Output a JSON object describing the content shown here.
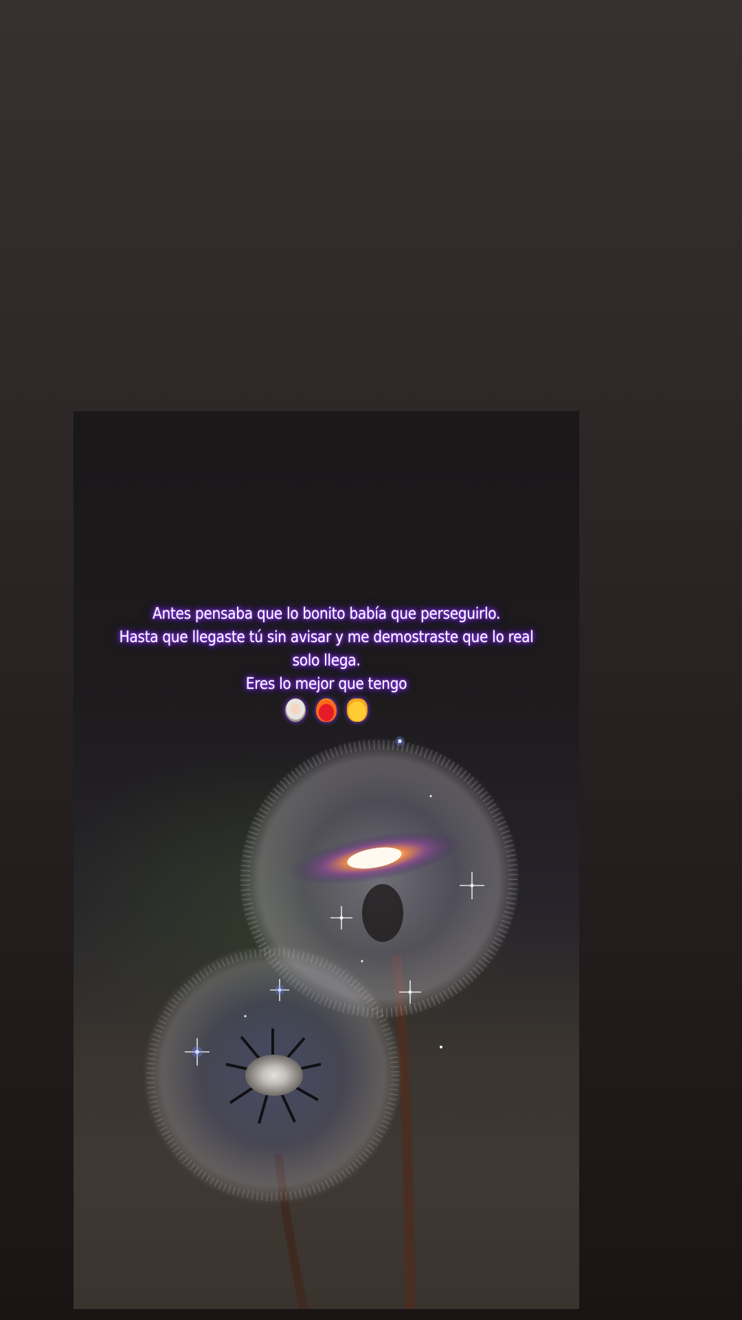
{
  "story": {
    "caption_lines": [
      "Antes pensaba que lo bonito babía que perseguirlo.",
      "Hasta que llegaste tú sin avisar y me demostraste que lo real",
      "solo llega.",
      "Eres lo mejor que tengo"
    ],
    "emojis": [
      "astronaut-icon",
      "heart-on-fire-icon",
      "crossed-fingers-icon"
    ],
    "glow_color": "#8a3cf0"
  }
}
